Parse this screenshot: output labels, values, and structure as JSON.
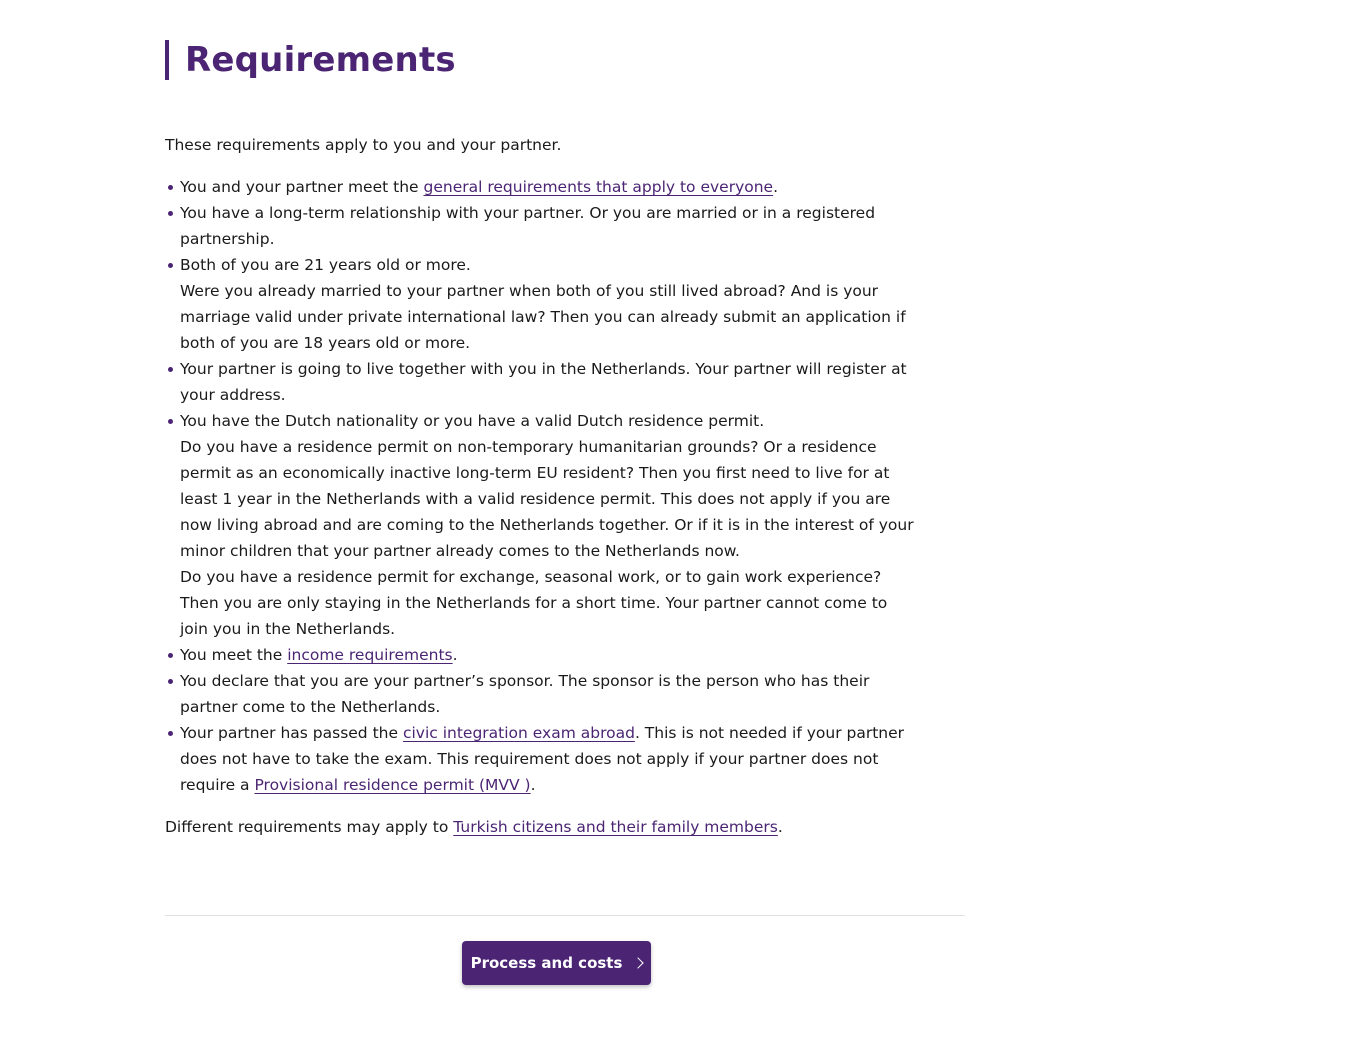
{
  "page": {
    "title": "Requirements",
    "intro": "These requirements apply to you and your partner.",
    "requirements": [
      {
        "before": "You and your partner meet the ",
        "link": "general requirements that apply to everyone",
        "after": "."
      },
      {
        "text": "You have a long-term relationship with your partner. Or you are married or in a registered partnership."
      },
      {
        "text": "Both of you are 21 years old or more.",
        "note": "Were you already married to your partner when both of you still lived abroad? And is your marriage valid under private international law? Then you can already submit an application if both of you are 18 years old or more."
      },
      {
        "text": "Your partner is going to live together with you in the Netherlands. Your partner will register at your address."
      },
      {
        "text": "You have the Dutch nationality or you have a valid Dutch residence permit.",
        "note1": "Do you have a residence permit on non-temporary humanitarian grounds? Or a residence permit as an economically inactive long-term EU resident? Then you first need to live for at least 1 year in the Netherlands with a valid residence permit. This does not apply if you are now living abroad and are coming to the Netherlands together. Or if it is in the interest of your minor children that your partner already comes to the Netherlands now.",
        "note2": "Do you have a residence permit for exchange, seasonal work, or to gain work experience? Then you are only staying in the Netherlands for a short time. Your partner cannot come to join you in the Netherlands."
      },
      {
        "before": "You meet the ",
        "link": "income requirements",
        "after": "."
      },
      {
        "text": "You declare that you are your partner’s sponsor. The sponsor is the person who has their partner come to the Netherlands."
      },
      {
        "before": "Your partner has passed the ",
        "link": "civic integration exam abroad",
        "middle": ". This is not needed if your partner does not have to take the exam. This requirement does not apply if your partner does not require a ",
        "link2": "Provisional residence permit (MVV )",
        "after": "."
      }
    ],
    "outro": {
      "before": "Different requirements may apply to ",
      "link": "Turkish citizens and their family members",
      "after": "."
    },
    "next_button": {
      "label": "Process and costs",
      "icon": "chevron-right-icon"
    }
  },
  "colors": {
    "accent": "#4b2574",
    "text": "#1a1a1a",
    "divider": "#e2e2e2"
  }
}
